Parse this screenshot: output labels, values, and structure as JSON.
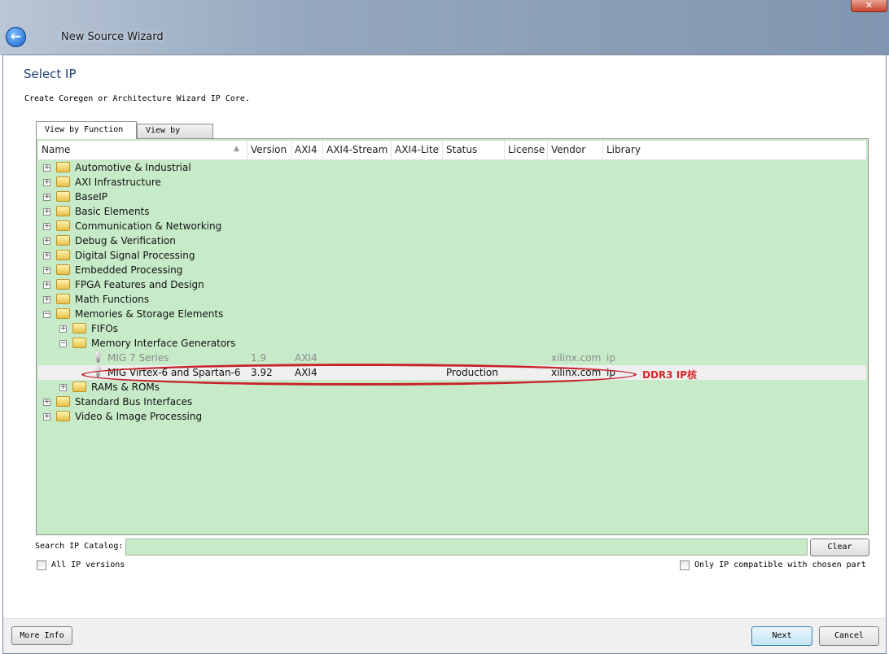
{
  "window": {
    "title": "New Source Wizard",
    "close_label": "✕"
  },
  "page": {
    "heading": "Select IP",
    "subtitle": "Create Coregen or Architecture Wizard IP Core."
  },
  "tabs": [
    {
      "label": "View by Function",
      "active": true
    },
    {
      "label": "View by Name",
      "active": false
    }
  ],
  "columns": [
    "Name",
    "Version",
    "AXI4",
    "AXI4-Stream",
    "AXI4-Lite",
    "Status",
    "License",
    "Vendor",
    "Library"
  ],
  "rows": [
    {
      "name": "Automotive & Industrial",
      "level": 0,
      "type": "folder",
      "expander": "+"
    },
    {
      "name": "AXI Infrastructure",
      "level": 0,
      "type": "folder",
      "expander": "+"
    },
    {
      "name": "BaseIP",
      "level": 0,
      "type": "folder",
      "expander": "+"
    },
    {
      "name": "Basic Elements",
      "level": 0,
      "type": "folder",
      "expander": "+"
    },
    {
      "name": "Communication & Networking",
      "level": 0,
      "type": "folder",
      "expander": "+"
    },
    {
      "name": "Debug & Verification",
      "level": 0,
      "type": "folder",
      "expander": "+"
    },
    {
      "name": "Digital Signal Processing",
      "level": 0,
      "type": "folder",
      "expander": "+"
    },
    {
      "name": "Embedded Processing",
      "level": 0,
      "type": "folder",
      "expander": "+"
    },
    {
      "name": "FPGA Features and Design",
      "level": 0,
      "type": "folder",
      "expander": "+"
    },
    {
      "name": "Math Functions",
      "level": 0,
      "type": "folder",
      "expander": "+"
    },
    {
      "name": "Memories & Storage Elements",
      "level": 0,
      "type": "folder",
      "expander": "−"
    },
    {
      "name": "FIFOs",
      "level": 1,
      "type": "folder",
      "expander": "+"
    },
    {
      "name": "Memory Interface Generators",
      "level": 1,
      "type": "folder",
      "expander": "−"
    },
    {
      "name": "MIG 7 Series",
      "level": 2,
      "type": "ip",
      "version": "1.9",
      "axi4": "AXI4",
      "status": "",
      "vendor": "xilinx.com",
      "library": "ip",
      "dim": true
    },
    {
      "name": "MIG Virtex-6 and Spartan-6",
      "level": 2,
      "type": "ip",
      "version": "3.92",
      "axi4": "AXI4",
      "status": "Production",
      "vendor": "xilinx.com",
      "library": "ip",
      "selected": true
    },
    {
      "name": "RAMs & ROMs",
      "level": 1,
      "type": "folder",
      "expander": "+"
    },
    {
      "name": "Standard Bus Interfaces",
      "level": 0,
      "type": "folder",
      "expander": "+"
    },
    {
      "name": "Video & Image Processing",
      "level": 0,
      "type": "folder",
      "expander": "+"
    }
  ],
  "annotation": "DDR3 IP核",
  "search": {
    "label": "Search IP Catalog:",
    "value": "",
    "clear_label": "Clear"
  },
  "options": {
    "all_versions": "All IP versions",
    "compatible_only": "Only IP compatible with chosen part"
  },
  "footer": {
    "more_info": "More Info",
    "next": "Next",
    "cancel": "Cancel"
  },
  "colors": {
    "tree_bg": "#c7ebc9",
    "annotation": "#c8232c"
  }
}
